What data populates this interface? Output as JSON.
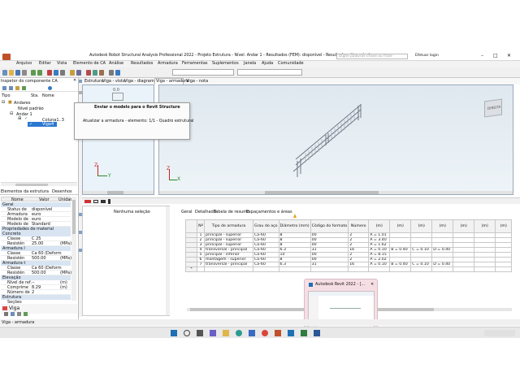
{
  "window": {
    "title": "Autodesk Robot Structural Analysis Professional 2022 - Projeto Estrutura - Nível: Andar 1 - Resultados (FEM): disponível - Resultados: disponível",
    "search_placeholder": "Digite palavras-chave ou frase",
    "user": "Efetuar login"
  },
  "menu": [
    "Arquivo",
    "Editar",
    "Vista",
    "Elemento de CA",
    "Análise",
    "Resultados",
    "Armadura",
    "Ferramentas",
    "Suplementos",
    "Janela",
    "Ajuda",
    "Comunidade"
  ],
  "inspector": {
    "title": "Inspetor do componente CA",
    "columns": [
      "Tipo",
      "Sta.",
      "Nome"
    ],
    "tree": [
      {
        "label": "Andares"
      },
      {
        "label": "Nível padrão"
      },
      {
        "label": "Andar 1"
      },
      {
        "label": "Coluna1..3"
      },
      {
        "label": "Viga4"
      }
    ],
    "tab_elements": "Elementos da estrutura",
    "tab_drawings": "Desenhos"
  },
  "properties": {
    "header": [
      "Nome",
      "Valor",
      "Unidad"
    ],
    "rows": [
      {
        "type": "section",
        "name": "Geral"
      },
      {
        "name": "Status de",
        "value": "disponível"
      },
      {
        "name": "Armadura",
        "value": "euro"
      },
      {
        "name": "Modelo de",
        "value": "euro"
      },
      {
        "name": "Modelo de",
        "value": "Standard"
      },
      {
        "type": "section",
        "name": "Propriedades de material"
      },
      {
        "type": "section",
        "name": "Concreto"
      },
      {
        "name": "Classe",
        "value": "C 25"
      },
      {
        "name": "Resistên",
        "value": "25.00",
        "unit": "(MPa)"
      },
      {
        "type": "section",
        "name": "Armadura l"
      },
      {
        "name": "Classe",
        "value": "Ca 60 (Deform"
      },
      {
        "name": "Resistên",
        "value": "500.00",
        "unit": "(MPa)"
      },
      {
        "type": "section",
        "name": "Armadura t"
      },
      {
        "name": "Classe",
        "value": "Ca 60 (Deform"
      },
      {
        "name": "Resistên",
        "value": "500.00",
        "unit": "(MPa)"
      },
      {
        "type": "section",
        "name": "Elevação"
      },
      {
        "name": "Nível de ref.",
        "value": "--",
        "unit": "(m)"
      },
      {
        "name": "Comprime",
        "value": "8.29",
        "unit": "(m)"
      },
      {
        "name": "Número de",
        "value": "2"
      },
      {
        "type": "section",
        "name": "Estrutura"
      },
      {
        "name": "Seções",
        "value": ""
      }
    ],
    "footer_label": "Viga"
  },
  "view_tabs": [
    "Estrutura",
    "Viga - vista",
    "Viga - diagramas",
    "Viga - armadura",
    "Viga - nota"
  ],
  "active_view_tab": "Viga - armadura",
  "viewcube_label": "DIREITA",
  "dialog": {
    "title": "Enviar o modelo para o Revit Structure",
    "message": "Atualizar a armadura - elemento: 1/1 - Quadro estrutural"
  },
  "selection": {
    "text": "Nenhuma seleção"
  },
  "table_tabs": [
    "Geral",
    "Detalhado",
    "Tabela de resumo",
    "Espaçamentos e áreas"
  ],
  "rebar_table": {
    "headers": [
      "Nº",
      "Tipo de armadura",
      "Grau do aço",
      "Diâmetro (mm)",
      "Código do formato",
      "Número",
      "(m)",
      "(m)",
      "(m)",
      "(m)",
      "(m)",
      "(m)",
      "(m)"
    ],
    "rows": [
      [
        "1",
        "principal - superior",
        "Ca-60",
        "8",
        "00",
        "2",
        "A = 1.01",
        "",
        "",
        "",
        "",
        "",
        ""
      ],
      [
        "2",
        "principal - superior",
        "Ca-60",
        "8",
        "00",
        "2",
        "A = 3.40",
        "",
        "",
        "",
        "",
        "",
        ""
      ],
      [
        "3",
        "principal - superior",
        "Ca-60",
        "8",
        "00",
        "2",
        "A = 1.62",
        "",
        "",
        "",
        "",
        "",
        ""
      ],
      [
        "4",
        "transversal - principal",
        "Ca-60",
        "6.3",
        "31",
        "16",
        "A = 0.10",
        "B = 0.40",
        "C = 0.10",
        "D = 0.40",
        "",
        "",
        ""
      ],
      [
        "5",
        "principal - inferior",
        "Ca-60",
        "10",
        "00",
        "2",
        "A = 8.15",
        "",
        "",
        "",
        "",
        "",
        ""
      ],
      [
        "6",
        "montagem - superior",
        "Ca-60",
        "8",
        "00",
        "2",
        "A = 2.02",
        "",
        "",
        "",
        "",
        "",
        ""
      ],
      [
        "7",
        "transversal - principal",
        "Ca-60",
        "6.3",
        "31",
        "16",
        "A = 0.10",
        "B = 0.40",
        "C = 0.10",
        "D = 0.40",
        "",
        "",
        ""
      ]
    ]
  },
  "taskbar_preview": {
    "title": "Autodesk Revit 2022 - [..."
  },
  "status": {
    "text": "Viga - armadura"
  },
  "colors": {
    "accent": "#1f6fb5",
    "selected": "#2b78d0",
    "section": "#d8e4f2"
  }
}
